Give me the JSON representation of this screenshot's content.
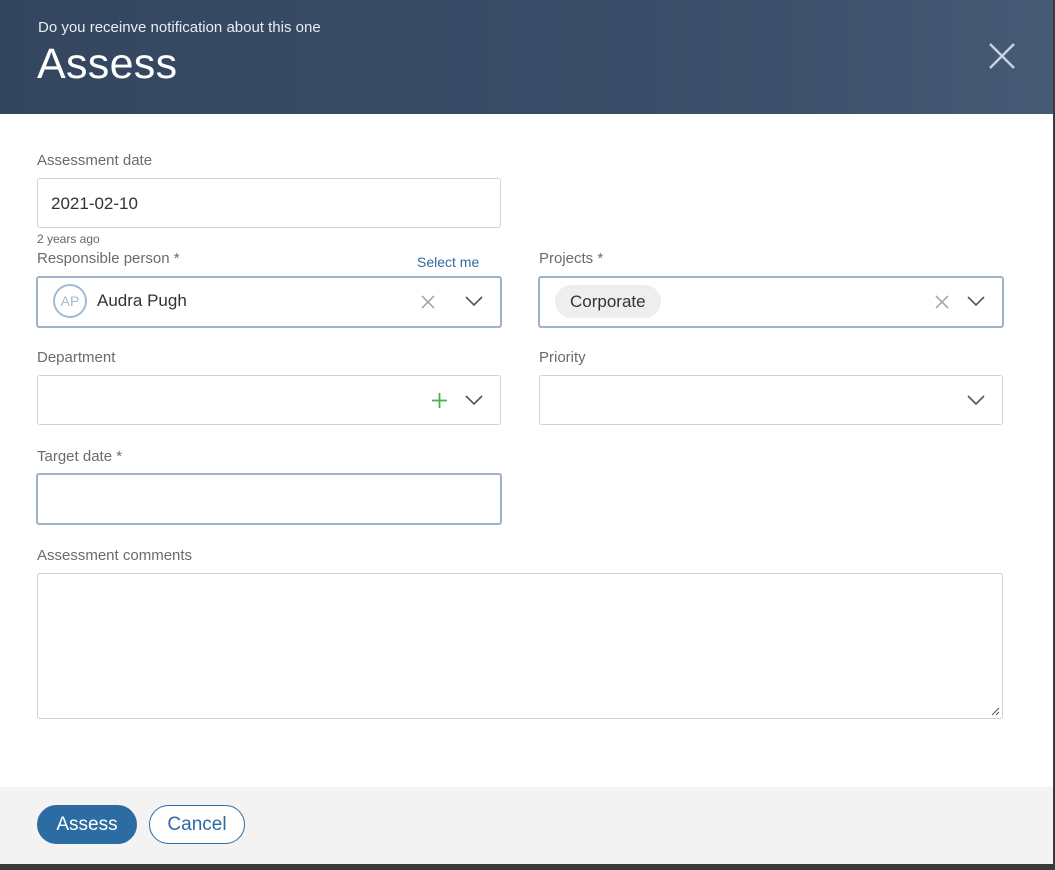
{
  "dialog": {
    "subtitle": "Do you receinve notification about this one",
    "title": "Assess"
  },
  "fields": {
    "assessment_date": {
      "label": "Assessment date",
      "value": "2021-02-10",
      "hint": "2 years ago"
    },
    "responsible_person": {
      "label": "Responsible person *",
      "select_me": "Select me",
      "avatar_initials": "AP",
      "value": "Audra Pugh"
    },
    "projects": {
      "label": "Projects *",
      "chip": "Corporate"
    },
    "department": {
      "label": "Department",
      "value": ""
    },
    "priority": {
      "label": "Priority",
      "value": ""
    },
    "target_date": {
      "label": "Target date *",
      "value": ""
    },
    "assessment_comments": {
      "label": "Assessment comments",
      "value": ""
    }
  },
  "footer": {
    "assess_label": "Assess",
    "cancel_label": "Cancel"
  },
  "colors": {
    "header": "#3a4c67",
    "primary": "#2d6ca3",
    "add_icon": "#4caf50"
  },
  "icons": [
    "close-icon",
    "clear-icon",
    "chevron-down-icon",
    "plus-icon",
    "resize-grip-icon"
  ]
}
